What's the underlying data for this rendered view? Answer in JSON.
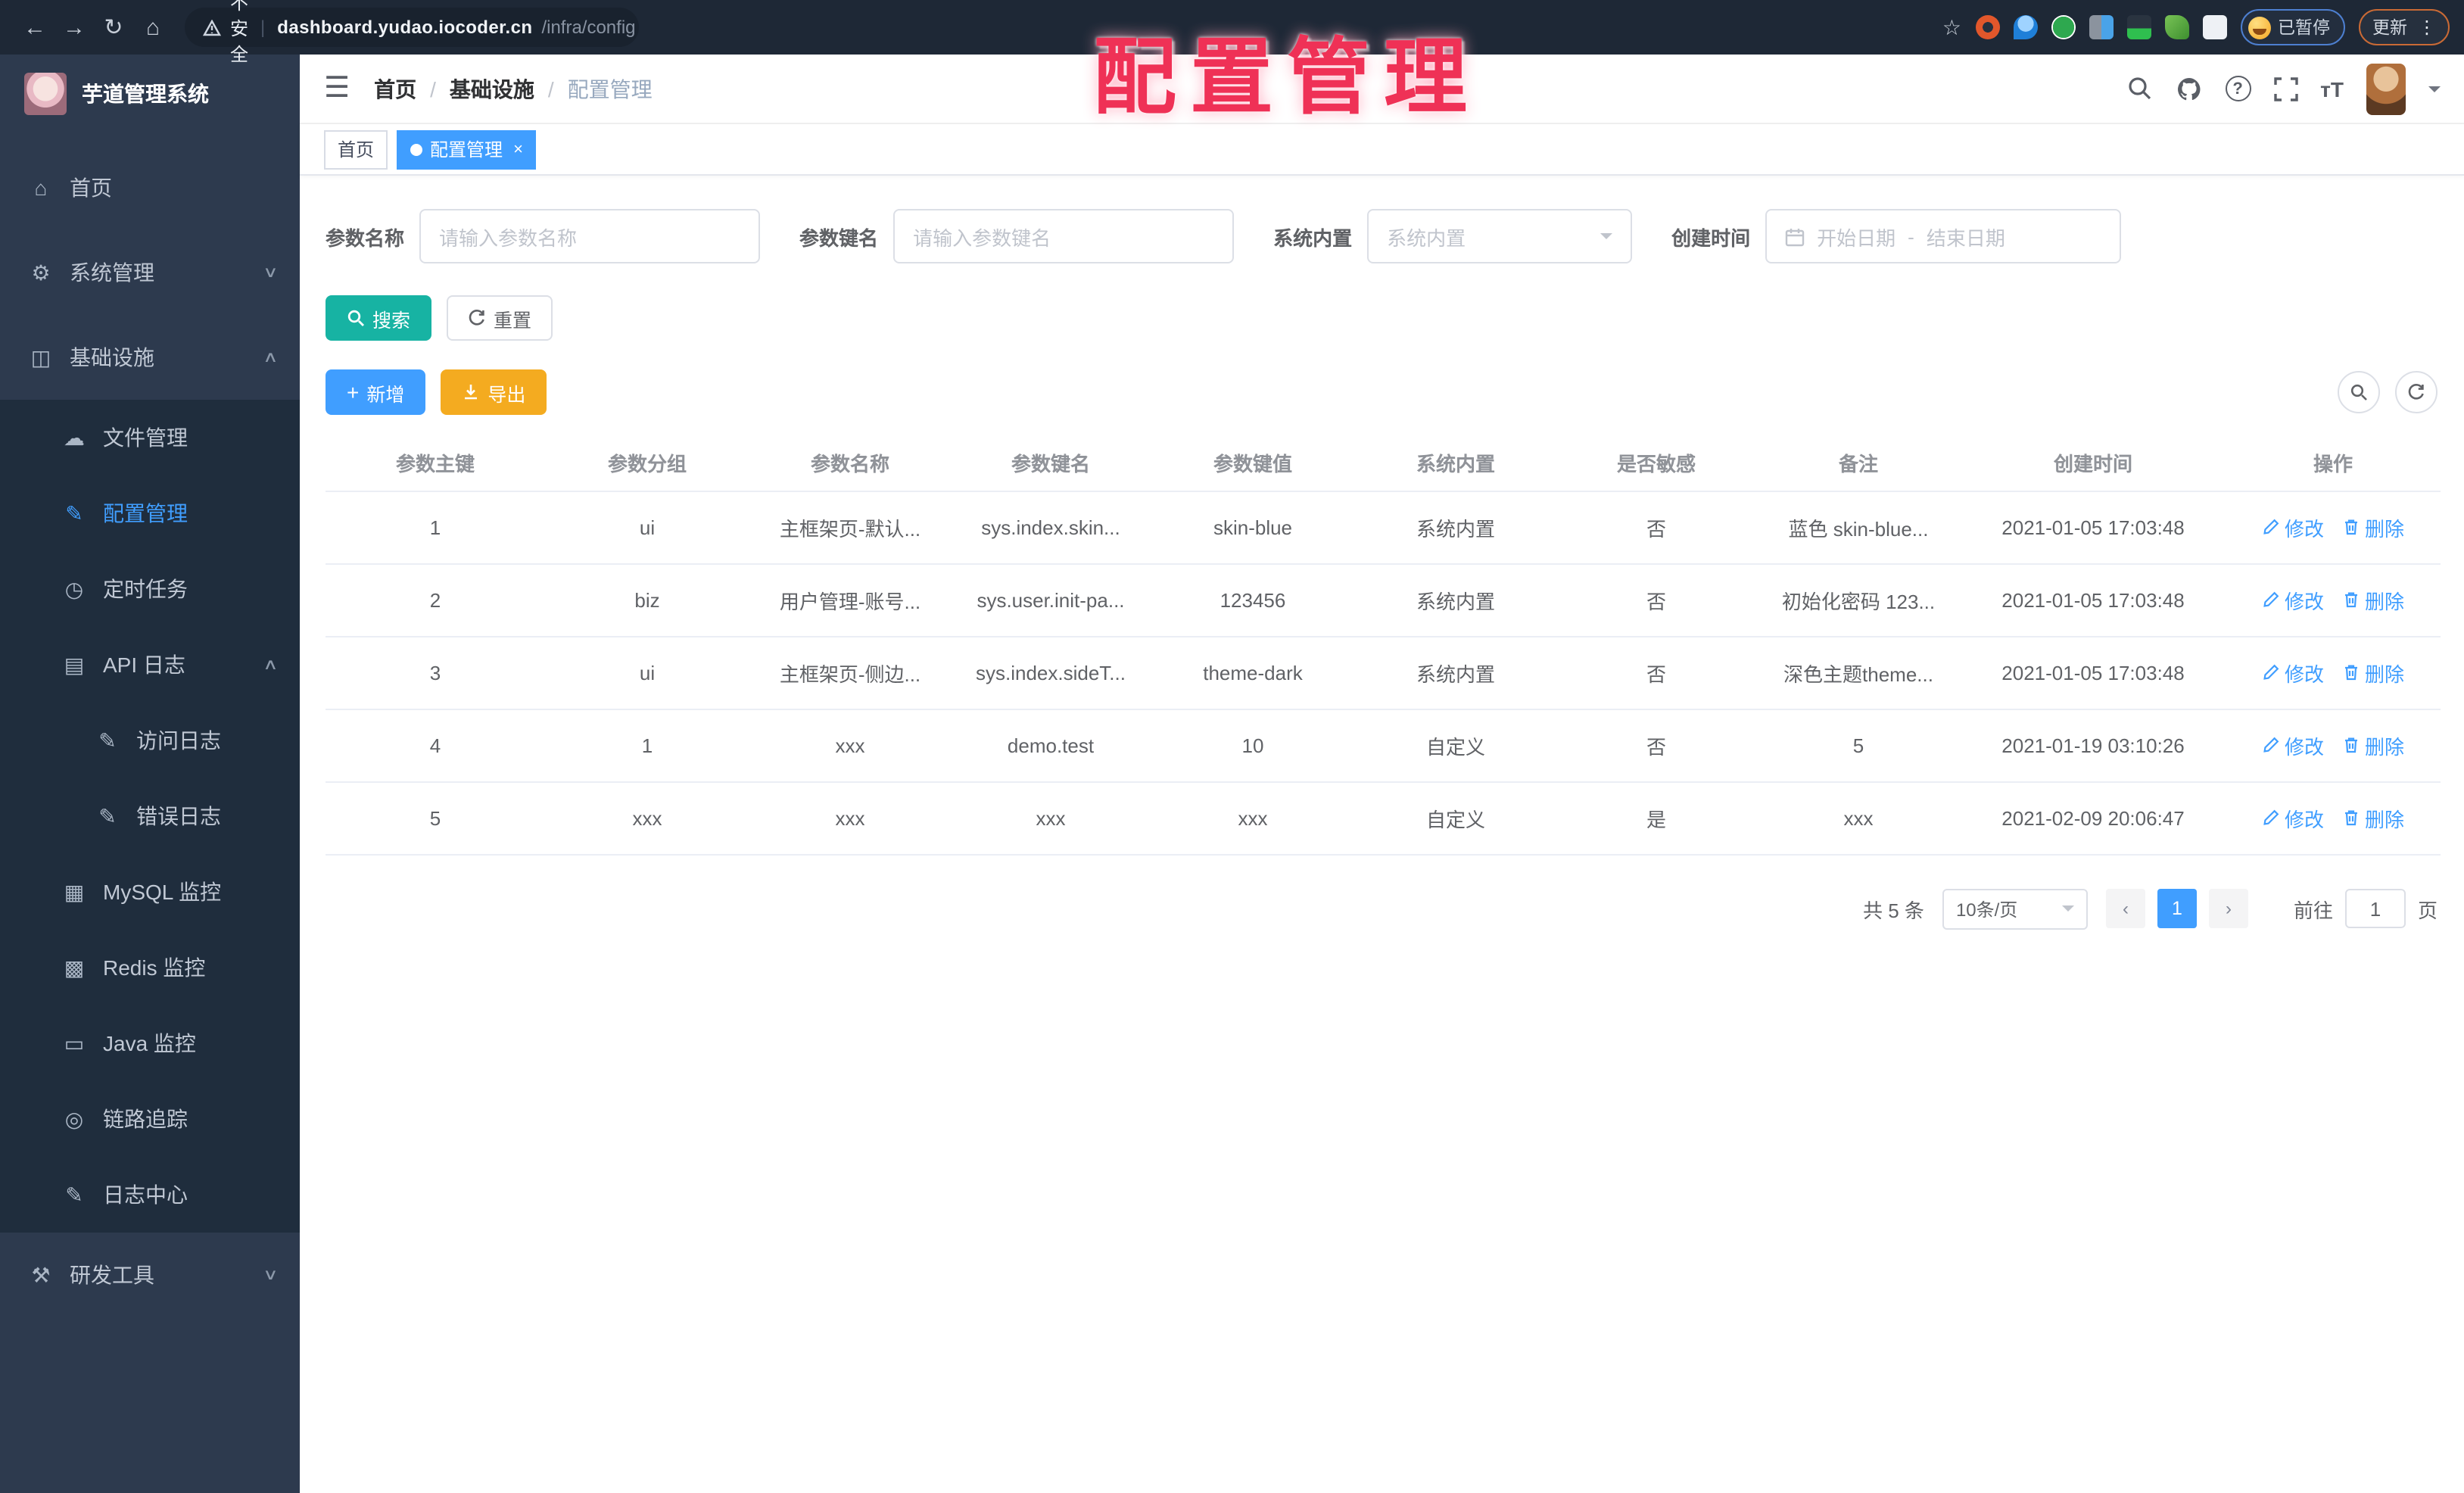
{
  "browser": {
    "warning_label": "不安全",
    "url_host": "dashboard.yudao.iocoder.cn",
    "url_path": "/infra/config",
    "paused_label": "已暂停",
    "update_label": "更新"
  },
  "overlay_title": "配置管理",
  "sidebar": {
    "app_title": "芋道管理系统",
    "menu": [
      {
        "label": "首页",
        "icon": "home-icon",
        "glyph": "⌂",
        "level": 0
      },
      {
        "label": "系统管理",
        "icon": "gear-icon",
        "glyph": "⚙",
        "level": 0,
        "arrow": "down"
      },
      {
        "label": "基础设施",
        "icon": "infrastructure-icon",
        "glyph": "◫",
        "level": 0,
        "arrow": "up"
      },
      {
        "label": "文件管理",
        "icon": "cloud-icon",
        "glyph": "☁",
        "level": 1
      },
      {
        "label": "配置管理",
        "icon": "edit-square-icon",
        "glyph": "✎",
        "level": 1,
        "active": true
      },
      {
        "label": "定时任务",
        "icon": "timer-icon",
        "glyph": "◷",
        "level": 1
      },
      {
        "label": "API 日志",
        "icon": "api-log-icon",
        "glyph": "▤",
        "level": 1,
        "arrow": "up"
      },
      {
        "label": "访问日志",
        "icon": "access-log-icon",
        "glyph": "✎",
        "level": 2
      },
      {
        "label": "错误日志",
        "icon": "error-log-icon",
        "glyph": "✎",
        "level": 2
      },
      {
        "label": "MySQL 监控",
        "icon": "mysql-monitor-icon",
        "glyph": "▦",
        "level": 1
      },
      {
        "label": "Redis 监控",
        "icon": "redis-monitor-icon",
        "glyph": "▩",
        "level": 1
      },
      {
        "label": "Java 监控",
        "icon": "java-monitor-icon",
        "glyph": "▭",
        "level": 1
      },
      {
        "label": "链路追踪",
        "icon": "trace-icon",
        "glyph": "◎",
        "level": 1
      },
      {
        "label": "日志中心",
        "icon": "log-center-icon",
        "glyph": "✎",
        "level": 1
      },
      {
        "label": "研发工具",
        "icon": "dev-tools-icon",
        "glyph": "⚒",
        "level": 0,
        "arrow": "down"
      }
    ]
  },
  "breadcrumb": [
    "首页",
    "基础设施",
    "配置管理"
  ],
  "tabs": [
    {
      "label": "首页"
    },
    {
      "label": "配置管理"
    }
  ],
  "filters": {
    "name_label": "参数名称",
    "name_placeholder": "请输入参数名称",
    "key_label": "参数键名",
    "key_placeholder": "请输入参数键名",
    "type_label": "系统内置",
    "type_placeholder": "系统内置",
    "date_label": "创建时间",
    "date_start": "开始日期",
    "date_separator": "-",
    "date_end": "结束日期"
  },
  "toolbar": {
    "search": "搜索",
    "reset": "重置",
    "add": "新增",
    "export": "导出"
  },
  "table": {
    "headers": [
      "参数主键",
      "参数分组",
      "参数名称",
      "参数键名",
      "参数键值",
      "系统内置",
      "是否敏感",
      "备注",
      "创建时间",
      "操作"
    ],
    "rows": [
      [
        "1",
        "ui",
        "主框架页-默认...",
        "sys.index.skin...",
        "skin-blue",
        "系统内置",
        "否",
        "蓝色 skin-blue...",
        "2021-01-05 17:03:48"
      ],
      [
        "2",
        "biz",
        "用户管理-账号...",
        "sys.user.init-pa...",
        "123456",
        "系统内置",
        "否",
        "初始化密码 123...",
        "2021-01-05 17:03:48"
      ],
      [
        "3",
        "ui",
        "主框架页-侧边...",
        "sys.index.sideT...",
        "theme-dark",
        "系统内置",
        "否",
        "深色主题theme...",
        "2021-01-05 17:03:48"
      ],
      [
        "4",
        "1",
        "xxx",
        "demo.test",
        "10",
        "自定义",
        "否",
        "5",
        "2021-01-19 03:10:26"
      ],
      [
        "5",
        "xxx",
        "xxx",
        "xxx",
        "xxx",
        "自定义",
        "是",
        "xxx",
        "2021-02-09 20:06:47"
      ]
    ],
    "ops": {
      "edit": "修改",
      "delete": "删除"
    }
  },
  "pagination": {
    "total": "共 5 条",
    "page_size": "10条/页",
    "prev": "‹",
    "current_page": "1",
    "next": "›",
    "goto_label": "前往",
    "goto_value": "1",
    "page_unit": "页"
  }
}
